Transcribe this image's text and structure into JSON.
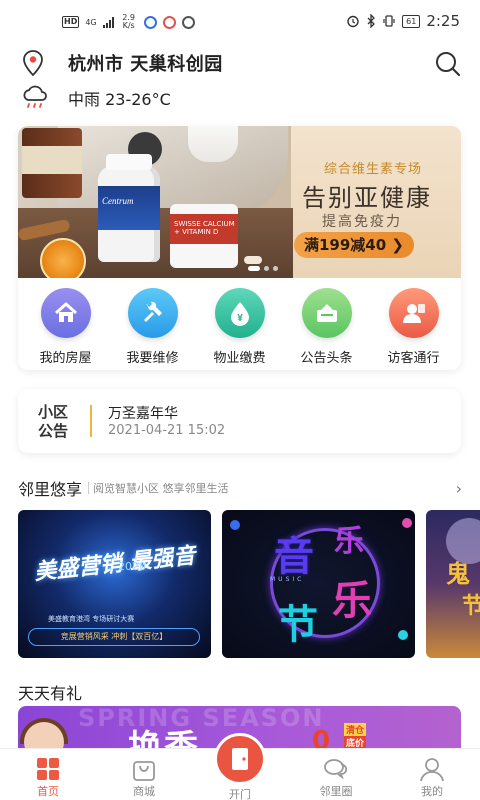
{
  "status_bar": {
    "hd": "HD",
    "network": "4G",
    "speed": "2.9 K/s",
    "battery": "61",
    "time": "2:25"
  },
  "header": {
    "location": "杭州市 天巢科创园",
    "weather": "中雨 23-26°C"
  },
  "banner": {
    "bottle_brand": "Centrum",
    "bottle2_label": "SWISSE CALCIUM + VITAMIN D",
    "subtitle": "综合维生素专场",
    "title": "告别亚健康",
    "tagline": "提高免疫力",
    "button": "满199减40 ❯"
  },
  "shortcuts": [
    {
      "label": "我的房屋",
      "icon": "house-icon",
      "color": "#7f7fe8"
    },
    {
      "label": "我要维修",
      "icon": "wrench-icon",
      "color": "#3db3f0"
    },
    {
      "label": "物业缴费",
      "icon": "yen-drop-icon",
      "color": "#35c6a5"
    },
    {
      "label": "公告头条",
      "icon": "notice-board-icon",
      "color": "#7ed37a"
    },
    {
      "label": "访客通行",
      "icon": "visitor-icon",
      "color": "#f2735a"
    }
  ],
  "notice": {
    "tag_line1": "小区",
    "tag_line2": "公告",
    "title": "万圣嘉年华",
    "time": "2021-04-21 15:02"
  },
  "neighbor": {
    "title": "邻里悠享",
    "desc": "阅览智慧小区 悠享邻里生活",
    "arrow": "›",
    "posters": [
      {
        "title": "美盛营销 最强音",
        "year": "2020",
        "sub": "美盛教育港湾 专场研讨大赛",
        "foot": "竞展营销风采 冲刺【双百亿】"
      },
      {
        "chars": [
          "音",
          "乐",
          "节",
          "乐"
        ],
        "music": "MUSIC"
      },
      {
        "text1": "鬼",
        "text2": "节"
      }
    ]
  },
  "daily": {
    "title": "天天有礼",
    "promo_bg": "SPRING SEASON",
    "promo_big": "换季",
    "promo_num": "0",
    "promo_tag1": "清仓",
    "promo_tag2": "底价"
  },
  "tabbar": [
    {
      "label": "首页",
      "icon": "home-grid-icon",
      "active": true
    },
    {
      "label": "商城",
      "icon": "shopping-bag-icon",
      "active": false
    },
    {
      "label": "开门",
      "icon": "door-icon",
      "active": false
    },
    {
      "label": "邻里圈",
      "icon": "chat-bubbles-icon",
      "active": false
    },
    {
      "label": "我的",
      "icon": "user-icon",
      "active": false
    }
  ],
  "colors": {
    "accent": "#ea5542",
    "notice_bar": "#f0b63a",
    "banner_button": "#e98a2a"
  }
}
